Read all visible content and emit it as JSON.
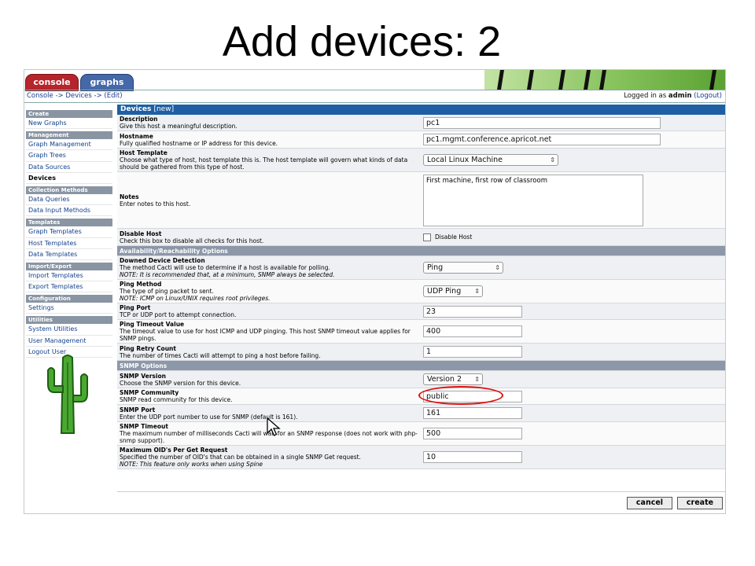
{
  "slide_title": "Add devices: 2",
  "tabs": {
    "console": "console",
    "graphs": "graphs"
  },
  "breadcrumb": "Console -> Devices -> (Edit)",
  "login": {
    "prefix": "Logged in as ",
    "user": "admin",
    "logout": "(Logout)"
  },
  "sidebar": [
    {
      "type": "head",
      "label": "Create"
    },
    {
      "type": "item",
      "label": "New Graphs"
    },
    {
      "type": "head",
      "label": "Management"
    },
    {
      "type": "item",
      "label": "Graph Management"
    },
    {
      "type": "item",
      "label": "Graph Trees"
    },
    {
      "type": "item",
      "label": "Data Sources"
    },
    {
      "type": "item",
      "label": "Devices",
      "selected": true
    },
    {
      "type": "head",
      "label": "Collection Methods"
    },
    {
      "type": "item",
      "label": "Data Queries"
    },
    {
      "type": "item",
      "label": "Data Input Methods"
    },
    {
      "type": "head",
      "label": "Templates"
    },
    {
      "type": "item",
      "label": "Graph Templates"
    },
    {
      "type": "item",
      "label": "Host Templates"
    },
    {
      "type": "item",
      "label": "Data Templates"
    },
    {
      "type": "head",
      "label": "Import/Export"
    },
    {
      "type": "item",
      "label": "Import Templates"
    },
    {
      "type": "item",
      "label": "Export Templates"
    },
    {
      "type": "head",
      "label": "Configuration"
    },
    {
      "type": "item",
      "label": "Settings"
    },
    {
      "type": "head",
      "label": "Utilities"
    },
    {
      "type": "item",
      "label": "System Utilities"
    },
    {
      "type": "item",
      "label": "User Management"
    },
    {
      "type": "item",
      "label": "Logout User"
    }
  ],
  "form": {
    "title": "Devices",
    "subtitle": "[new]",
    "description": {
      "label": "Description",
      "help": "Give this host a meaningful description.",
      "value": "pc1"
    },
    "hostname": {
      "label": "Hostname",
      "help": "Fully qualified hostname or IP address for this device.",
      "value": "pc1.mgmt.conference.apricot.net"
    },
    "host_template": {
      "label": "Host Template",
      "help": "Choose what type of host, host template this is. The host template will govern what kinds of data should be gathered from this type of host.",
      "value": "Local Linux Machine"
    },
    "notes": {
      "label": "Notes",
      "help": "Enter notes to this host.",
      "value": "First machine, first row of classroom"
    },
    "disable_host": {
      "label": "Disable Host",
      "help": "Check this box to disable all checks for this host.",
      "checkbox_label": "Disable Host"
    },
    "section_availability": "Availability/Reachability Options",
    "downed_detection": {
      "label": "Downed Device Detection",
      "help": "The method Cacti will use to determine if a host is available for polling.",
      "note": "NOTE: It is recommended that, at a minimum, SNMP always be selected.",
      "value": "Ping"
    },
    "ping_method": {
      "label": "Ping Method",
      "help": "The type of ping packet to sent.",
      "note": "NOTE: ICMP on Linux/UNIX requires root privileges.",
      "value": "UDP Ping"
    },
    "ping_port": {
      "label": "Ping Port",
      "help": "TCP or UDP port to attempt connection.",
      "value": "23"
    },
    "ping_timeout": {
      "label": "Ping Timeout Value",
      "help": "The timeout value to use for host ICMP and UDP pinging. This host SNMP timeout value applies for SNMP pings.",
      "value": "400"
    },
    "ping_retry": {
      "label": "Ping Retry Count",
      "help": "The number of times Cacti will attempt to ping a host before failing.",
      "value": "1"
    },
    "section_snmp": "SNMP Options",
    "snmp_version": {
      "label": "SNMP Version",
      "help": "Choose the SNMP version for this device.",
      "value": "Version 2"
    },
    "snmp_community": {
      "label": "SNMP Community",
      "help": "SNMP read community for this device.",
      "value": "public"
    },
    "snmp_port": {
      "label": "SNMP Port",
      "help": "Enter the UDP port number to use for SNMP (default is 161).",
      "value": "161"
    },
    "snmp_timeout": {
      "label": "SNMP Timeout",
      "help": "The maximum number of milliseconds Cacti will wait for an SNMP response (does not work with php-snmp support).",
      "value": "500"
    },
    "max_oids": {
      "label": "Maximum OID's Per Get Request",
      "help": "Specified the number of OID's that can be obtained in a single SNMP Get request.",
      "note": "NOTE: This feature only works when using Spine",
      "value": "10"
    }
  },
  "buttons": {
    "cancel": "cancel",
    "create": "create"
  },
  "icons": {
    "cactus": "cactus-logo-icon",
    "cursor": "mouse-pointer-icon"
  },
  "colors": {
    "accent": "#1e5fa3",
    "highlight_circle": "#e01010",
    "console_tab": "#b5252b",
    "graphs_tab": "#4468a8"
  }
}
